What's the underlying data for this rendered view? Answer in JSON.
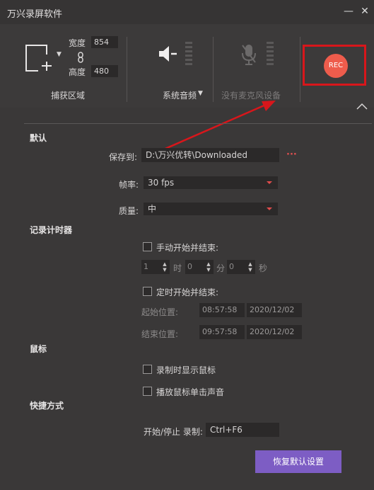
{
  "window": {
    "title": "万兴录屏软件",
    "minimize_glyph": "—",
    "close_glyph": "✕"
  },
  "capture": {
    "width_label": "宽度",
    "width_value": "854",
    "height_label": "高度",
    "height_value": "480",
    "area_label": "捕获区域"
  },
  "audio": {
    "system_label": "系统音频",
    "mic_label": "没有麦克风设备"
  },
  "rec": {
    "label": "REC"
  },
  "defaults": {
    "section_title": "默认",
    "save_to_label": "保存到:",
    "save_path": "D:\\万兴优转\\Downloaded",
    "browse_label": "···",
    "fps_label": "帧率:",
    "fps_value": "30 fps",
    "quality_label": "质量:",
    "quality_value": "中"
  },
  "timer": {
    "section_title": "记录计时器",
    "manual_label": "手动开始并结束:",
    "hours_value": "1",
    "hours_unit": "时",
    "minutes_value": "0",
    "minutes_unit": "分",
    "seconds_value": "0",
    "seconds_unit": "秒",
    "scheduled_label": "定时开始并结束:",
    "start_label": "起始位置:",
    "start_time": "08:57:58",
    "start_date": "2020/12/02",
    "end_label": "结束位置:",
    "end_time": "09:57:58",
    "end_date": "2020/12/02"
  },
  "mouse": {
    "section_title": "鼠标",
    "show_cursor_label": "录制时显示鼠标",
    "click_sound_label": "播放鼠标单击声音"
  },
  "shortcuts": {
    "section_title": "快捷方式",
    "start_stop_label": "开始/停止 录制:",
    "start_stop_value": "Ctrl+F6"
  },
  "footer": {
    "restore_label": "恢复默认设置"
  },
  "colors": {
    "accent_purple": "#7d5dc4",
    "rec_red": "#ee5c4c",
    "annotation_red": "#d8161b"
  }
}
